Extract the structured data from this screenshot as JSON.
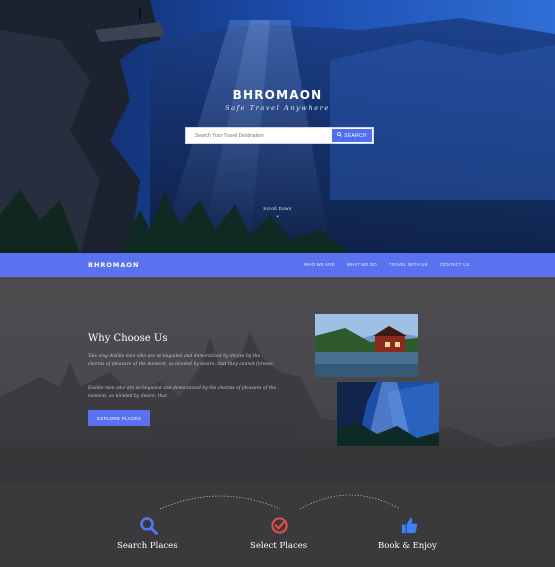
{
  "hero": {
    "title": "BHROMAON",
    "tagline": "Safe Travel Anywhere",
    "search_placeholder": "Search Your Travel Destination",
    "search_button": "SEARCH",
    "scroll_label": "Scroll Down"
  },
  "navbar": {
    "brand": "BHROMAON",
    "links": [
      "WHO WE ARE",
      "WHAT WE DO",
      "TRAVEL WITH US",
      "CONTACT US"
    ]
  },
  "why": {
    "title": "Why Choose Us",
    "paragraph_1": "Tais sing dislike men who are so beguiled and demoralized by decive by the charms of pleasure of the moment, so blinded by desire, that they cannot foresee.",
    "paragraph_2": "Dislike men who are so beguiled and demoralized by the charms of pleasure of the moment, so blinded by desire, that",
    "button": "EXPLORE PLACES"
  },
  "features": [
    {
      "label": "Search Places",
      "icon": "search-icon"
    },
    {
      "label": "Select Places",
      "icon": "check-circle-icon"
    },
    {
      "label": "Book & Enjoy",
      "icon": "thumbs-up-icon"
    }
  ],
  "colors": {
    "accent": "#5a72f0",
    "search_icon": "#5a72f0",
    "check_icon": "#e74c4c",
    "thumb_icon": "#3b82f6",
    "dark_bg": "#3a3a3c"
  }
}
